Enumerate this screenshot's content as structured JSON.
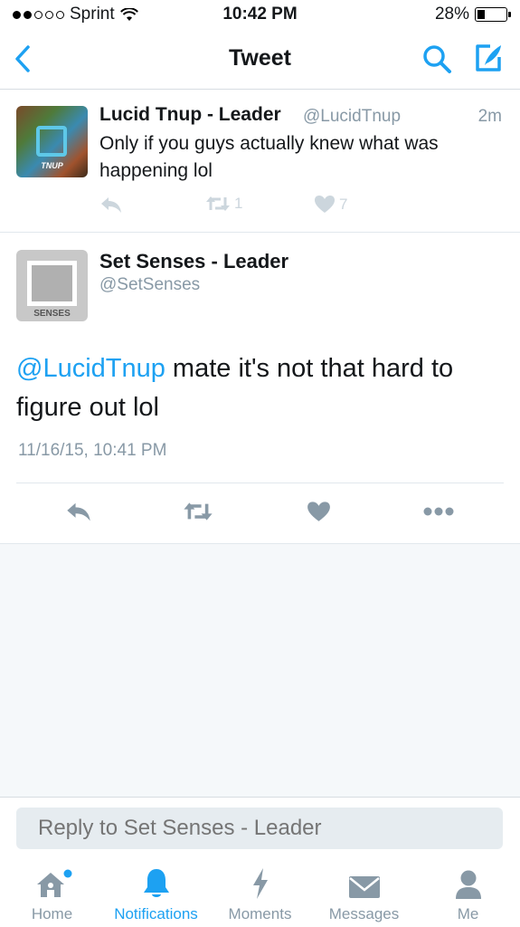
{
  "status_bar": {
    "carrier": "Sprint",
    "time": "10:42 PM",
    "battery": "28%",
    "battery_level": 0.28,
    "signal_bars_filled": 2
  },
  "navbar": {
    "title": "Tweet"
  },
  "reply_tweet": {
    "author": "Lucid Tnup - Leader",
    "handle": "@LucidTnup",
    "time": "2m",
    "text": "Only if you guys actually knew what was happening lol",
    "avatar_text": "TNUP",
    "retweet_count": "1",
    "like_count": "7"
  },
  "main_tweet": {
    "author": "Set Senses - Leader",
    "handle": "@SetSenses",
    "avatar_text": "SENSES",
    "mention": "@LucidTnup",
    "text": " mate it's not that hard to figure out lol",
    "date": "11/16/15, 10:41 PM"
  },
  "reply_bar": {
    "placeholder": "Reply to Set Senses - Leader"
  },
  "tabs": [
    {
      "label": "Home",
      "icon": "home-icon"
    },
    {
      "label": "Notifications",
      "icon": "bell-icon"
    },
    {
      "label": "Moments",
      "icon": "lightning-icon"
    },
    {
      "label": "Messages",
      "icon": "envelope-icon"
    },
    {
      "label": "Me",
      "icon": "person-icon"
    }
  ],
  "colors": {
    "accent": "#1da1f2",
    "gray": "#8899a6",
    "light_icon": "#ccd6dd"
  }
}
